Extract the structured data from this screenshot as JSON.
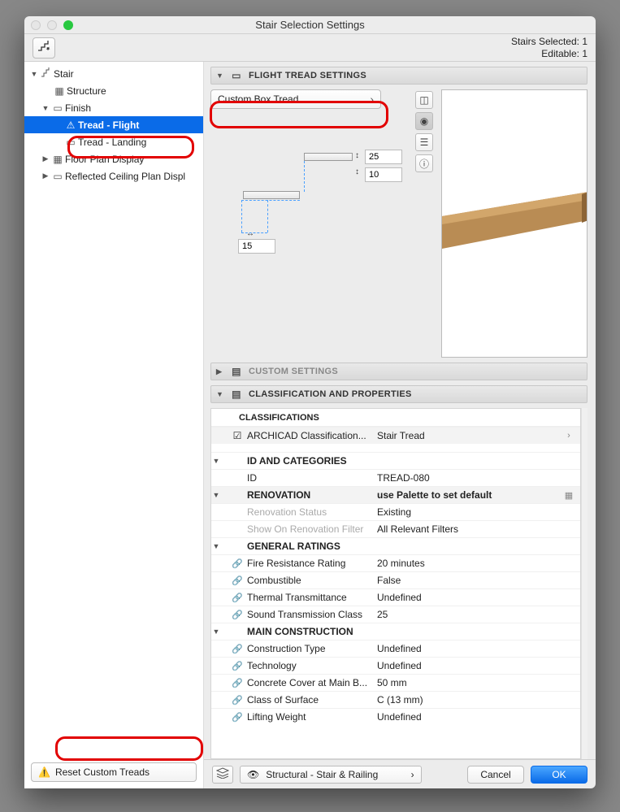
{
  "window": {
    "title": "Stair Selection Settings"
  },
  "status": {
    "selected_label": "Stairs Selected: 1",
    "editable_label": "Editable: 1"
  },
  "tree": {
    "stair": "Stair",
    "structure": "Structure",
    "finish": "Finish",
    "tread_flight": "Tread - Flight",
    "tread_landing": "Tread - Landing",
    "floor_plan": "Floor Plan Display",
    "rcp": "Reflected Ceiling Plan Displ"
  },
  "reset": {
    "label": "Reset Custom Treads"
  },
  "sections": {
    "flight": "FLIGHT TREAD SETTINGS",
    "custom": "CUSTOM SETTINGS",
    "classif": "CLASSIFICATION AND PROPERTIES"
  },
  "flight": {
    "type_label": "Custom Box Tread",
    "dim_top": "25",
    "dim_mid": "10",
    "dim_bot": "15"
  },
  "classif": {
    "group_classifications": "CLASSIFICATIONS",
    "archicad_label": "ARCHICAD Classification...",
    "archicad_value": "Stair Tread",
    "group_id": "ID AND CATEGORIES",
    "id_label": "ID",
    "id_value": "TREAD-080",
    "group_reno": "RENOVATION",
    "reno_hint": "use Palette to set default",
    "reno_status_label": "Renovation Status",
    "reno_status_value": "Existing",
    "reno_show_label": "Show On Renovation Filter",
    "reno_show_value": "All Relevant Filters",
    "group_ratings": "GENERAL RATINGS",
    "fire_label": "Fire Resistance Rating",
    "fire_value": "20 minutes",
    "combust_label": "Combustible",
    "combust_value": "False",
    "thermal_label": "Thermal Transmittance",
    "thermal_value": "Undefined",
    "stc_label": "Sound Transmission Class",
    "stc_value": "25",
    "group_main": "MAIN CONSTRUCTION",
    "ctype_label": "Construction Type",
    "ctype_value": "Undefined",
    "tech_label": "Technology",
    "tech_value": "Undefined",
    "cover_label": "Concrete Cover at Main B...",
    "cover_value": "50 mm",
    "surface_label": "Class of Surface",
    "surface_value": "C (13 mm)",
    "lifting_label": "Lifting Weight",
    "lifting_value": "Undefined"
  },
  "footer": {
    "layer": "Structural - Stair & Railing",
    "cancel": "Cancel",
    "ok": "OK"
  }
}
